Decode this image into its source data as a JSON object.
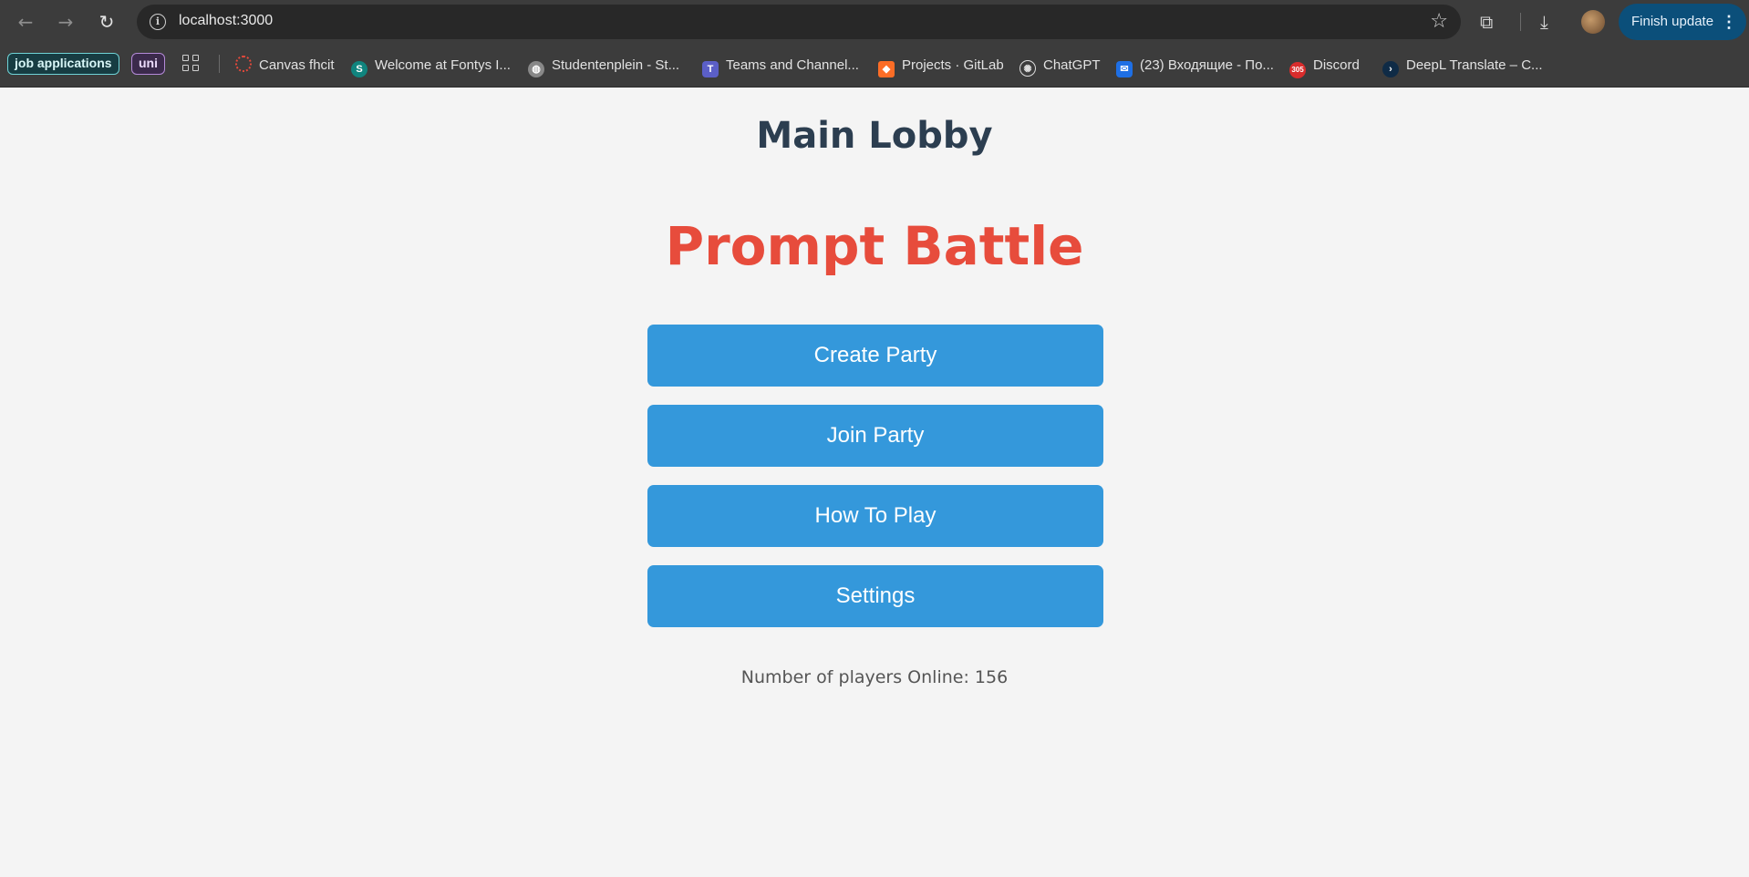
{
  "browser": {
    "url": "localhost:3000",
    "update_label": "Finish update",
    "bookmarks": {
      "job_applications": "job applications",
      "uni": "uni",
      "canvas": "Canvas fhcit",
      "fontys": "Welcome at Fontys I...",
      "studentenplein": "Studentenplein - St...",
      "teams": "Teams and Channel...",
      "gitlab": "Projects · GitLab",
      "chatgpt": "ChatGPT",
      "mail": "(23) Входящие - По...",
      "discord": "Discord",
      "deepl": "DeepL Translate – C..."
    },
    "discord_badge": "305"
  },
  "page": {
    "lobby_title": "Main Lobby",
    "game_title": "Prompt Battle",
    "buttons": {
      "create": "Create Party",
      "join": "Join Party",
      "how_to": "How To Play",
      "settings": "Settings"
    },
    "players_online": "Number of players Online: 156"
  },
  "colors": {
    "lobby_title": "#2c3e50",
    "game_title": "#e74c3c",
    "button": "#3498db",
    "background": "#f4f4f4"
  }
}
